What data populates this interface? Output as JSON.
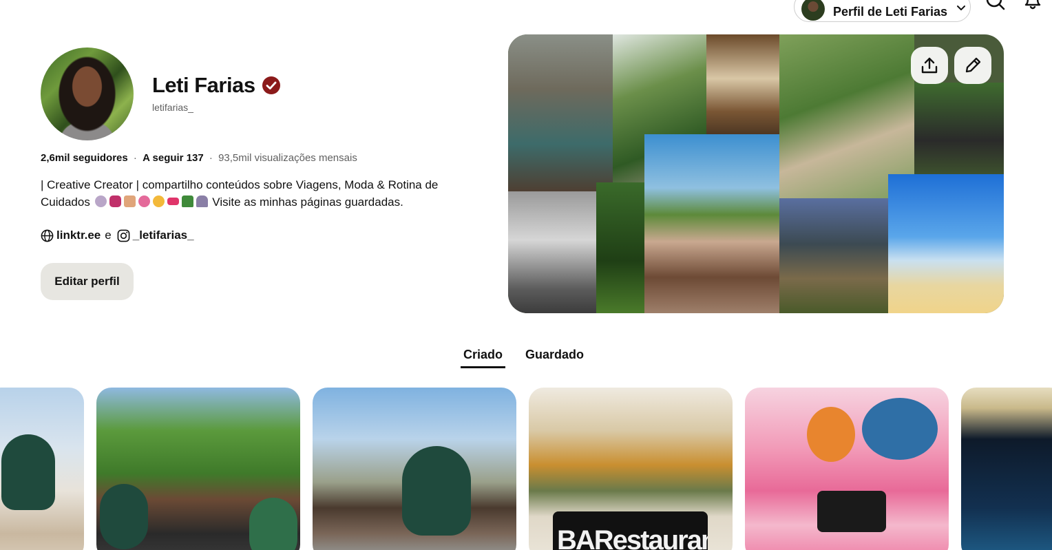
{
  "topbar": {
    "profile_switch_label": "Perfil de Leti Farias"
  },
  "profile": {
    "name": "Leti Farias",
    "handle": "letifarias_",
    "followers": "2,6mil seguidores",
    "stat_separator": "·",
    "following": "A seguir 137",
    "monthly_views": "93,5mil visualizações mensais",
    "bio_line1": "| Creative Creator | compartilho conteúdos sobre Viagens, Moda & Rotina de",
    "bio_line2_start": "Cuidados",
    "bio_line2_end": "Visite as minhas páginas guardadas.",
    "bio_emojis": [
      "crystal-ball",
      "butterfly",
      "leg",
      "hibiscus",
      "smiley",
      "ticket",
      "palm-tree",
      "person-at-laptop"
    ],
    "website_link": "linktr.ee",
    "links_conjunction": "e",
    "instagram_link": "_letifarias_",
    "edit_button": "Editar perfil"
  },
  "tabs": [
    {
      "label": "Criado",
      "active": true
    },
    {
      "label": "Guardado",
      "active": false
    }
  ],
  "pins": {
    "restaurant_sign": "BARestaurante"
  },
  "colors": {
    "verified_badge": "#8b1a1a",
    "edit_button_bg": "#e7e6e1",
    "text": "#111111",
    "muted_text": "#5f5f5f"
  },
  "icons": [
    "chevron-down-icon",
    "search-icon",
    "bell-icon",
    "verified-badge-icon",
    "globe-icon",
    "instagram-icon",
    "share-icon",
    "pencil-icon"
  ]
}
